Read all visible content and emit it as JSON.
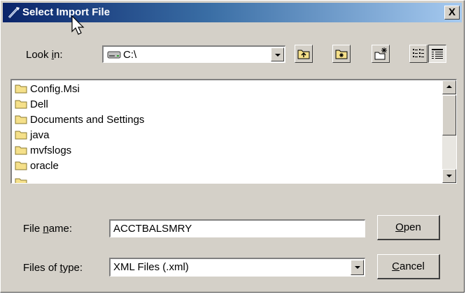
{
  "window": {
    "title": "Select Import File",
    "close_glyph": "X"
  },
  "lookin": {
    "label_pre": "Look ",
    "label_u": "i",
    "label_post": "n:",
    "value": "C:\\",
    "icon": "drive-icon"
  },
  "toolbar": {
    "buttons": [
      "up-one-level-icon",
      "desktop-icon",
      "new-folder-icon",
      "list-view-icon",
      "details-view-icon"
    ]
  },
  "files": {
    "items": [
      {
        "name": "Config.Msi"
      },
      {
        "name": "Dell"
      },
      {
        "name": "Documents and Settings"
      },
      {
        "name": "java"
      },
      {
        "name": "mvfslogs"
      },
      {
        "name": "oracle"
      }
    ]
  },
  "filename": {
    "label_pre": "File ",
    "label_u": "n",
    "label_post": "ame:",
    "value": "ACCTBALSMRY"
  },
  "filetype": {
    "label_pre": "Files of ",
    "label_u": "t",
    "label_post": "ype:",
    "value": "XML Files (.xml)"
  },
  "buttons": {
    "open_u": "O",
    "open_rest": "pen",
    "cancel_u": "C",
    "cancel_rest": "ancel"
  },
  "colors": {
    "titlebar_start": "#0a246a",
    "titlebar_end": "#a6caf0",
    "dialog_bg": "#d4d0c8",
    "folder": "#f5e08a"
  }
}
